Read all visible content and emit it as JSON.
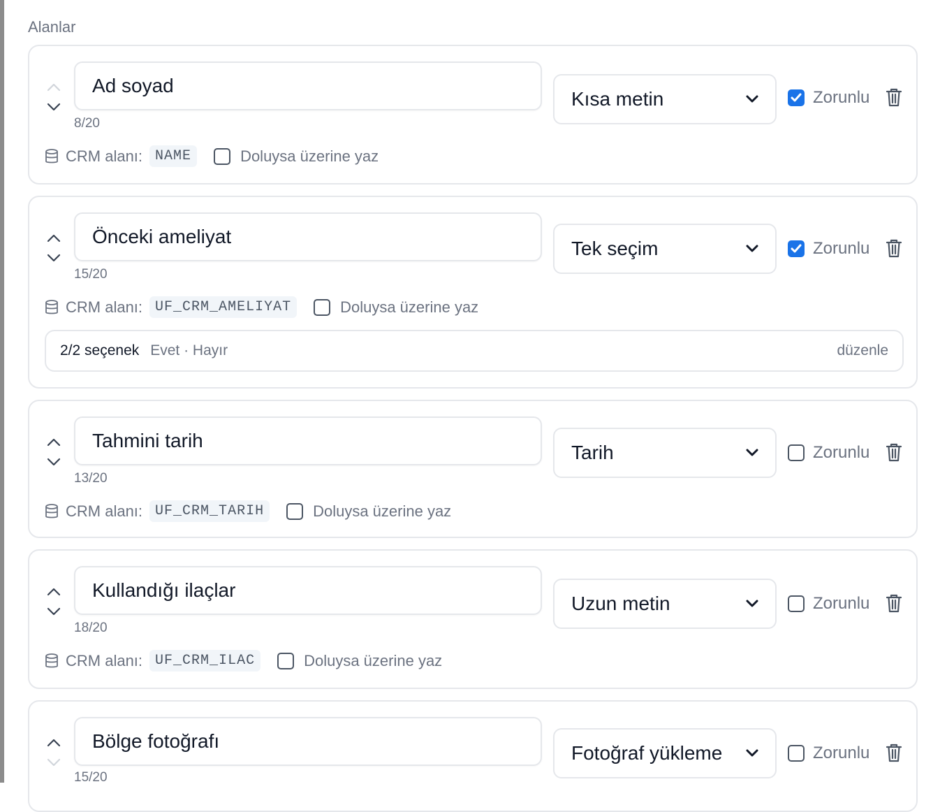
{
  "section_title": "Alanlar",
  "fields": [
    {
      "name": "Ad soyad",
      "counter": "8/20",
      "type": "Kısa metin",
      "required": true,
      "required_label": "Zorunlu",
      "crm_label": "CRM alanı:",
      "crm_code": "NAME",
      "overwrite_label": "Doluysa üzerine yaz",
      "overwrite": false,
      "up_enabled": false,
      "down_enabled": true
    },
    {
      "name": "Önceki ameliyat",
      "counter": "15/20",
      "type": "Tek seçim",
      "required": true,
      "required_label": "Zorunlu",
      "crm_label": "CRM alanı:",
      "crm_code": "UF_CRM_AMELIYAT",
      "overwrite_label": "Doluysa üzerine yaz",
      "overwrite": false,
      "up_enabled": true,
      "down_enabled": true,
      "options": {
        "count": "2/2 seçenek",
        "values": "Evet · Hayır",
        "edit_label": "düzenle"
      }
    },
    {
      "name": "Tahmini tarih",
      "counter": "13/20",
      "type": "Tarih",
      "required": false,
      "required_label": "Zorunlu",
      "crm_label": "CRM alanı:",
      "crm_code": "UF_CRM_TARIH",
      "overwrite_label": "Doluysa üzerine yaz",
      "overwrite": false,
      "up_enabled": true,
      "down_enabled": true
    },
    {
      "name": "Kullandığı ilaçlar",
      "counter": "18/20",
      "type": "Uzun metin",
      "required": false,
      "required_label": "Zorunlu",
      "crm_label": "CRM alanı:",
      "crm_code": "UF_CRM_ILAC",
      "overwrite_label": "Doluysa üzerine yaz",
      "overwrite": false,
      "up_enabled": true,
      "down_enabled": true
    },
    {
      "name": "Bölge fotoğrafı",
      "counter": "15/20",
      "type": "Fotoğraf yükleme",
      "required": false,
      "required_label": "Zorunlu",
      "up_enabled": true,
      "down_enabled": false
    }
  ],
  "colors": {
    "accent": "#1a73e8",
    "border": "#e5e7eb",
    "muted_text": "#6b7280"
  },
  "icons": {
    "up": "chevron-up-icon",
    "down": "chevron-down-icon",
    "delete": "trash-icon",
    "crm": "database-icon",
    "select": "chevron-down-icon"
  }
}
